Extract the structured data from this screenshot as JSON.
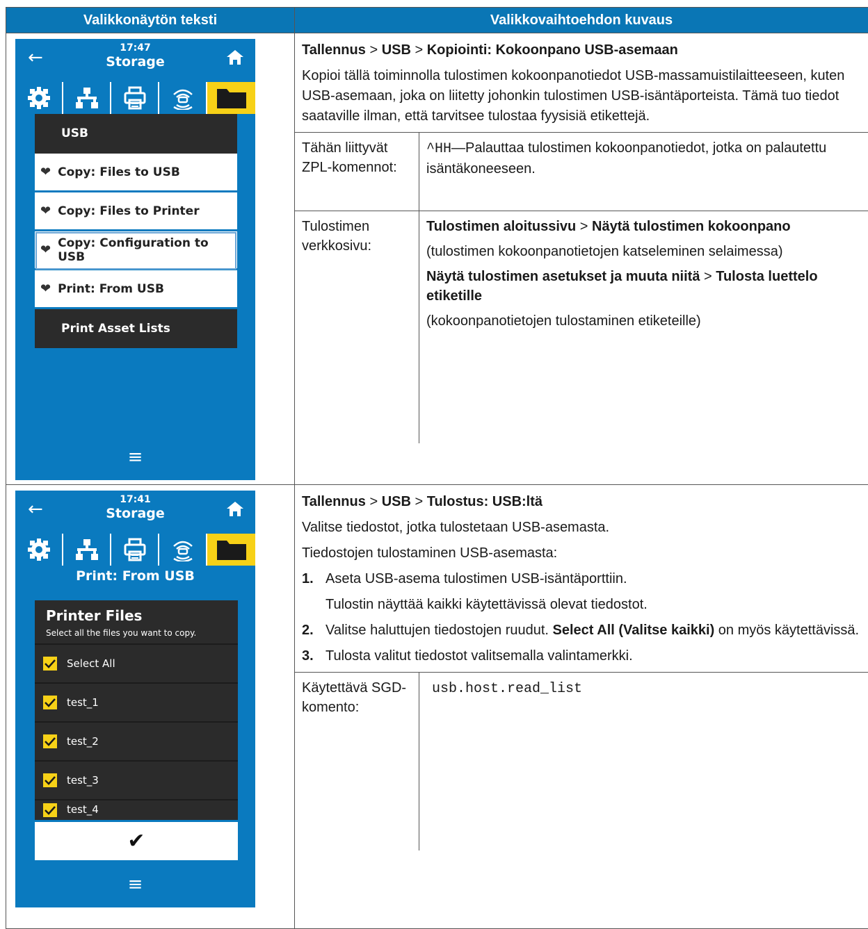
{
  "header": {
    "left": "Valikkonäytön teksti",
    "right": "Valikkovaihtoehdon kuvaus"
  },
  "colors": {
    "header_blue": "#0a76b5",
    "screen_blue": "#0a7abf",
    "active_tab_yellow": "#f7d117",
    "dark_panel": "#2b2b2b"
  },
  "row1": {
    "screen": {
      "time": "17:47",
      "title": "Storage",
      "icons": [
        "back-arrow-icon",
        "home-icon",
        "gear-icon",
        "network-icon",
        "printer-icon",
        "wireless-icon",
        "folder-icon"
      ],
      "menu_title": "USB",
      "items": [
        "Copy: Files to USB",
        "Copy: Files to Printer",
        "Copy: Configuration to USB",
        "Print: From USB"
      ],
      "selected_item": "Copy: Configuration to USB",
      "bottom_item": "Print Asset Lists"
    },
    "crumb": {
      "a": "Tallennus",
      "sep": ">",
      "b": "USB",
      "c": "Kopiointi: Kokoonpano USB-asemaan"
    },
    "description": "Kopioi tällä toiminnolla tulostimen kokoonpanotiedot USB-massamuistilaitteeseen, kuten USB-asemaan, joka on liitetty johonkin tulostimen USB-isäntäporteista. Tämä tuo tiedot saataville ilman, että tarvitsee tulostaa fyysisiä etikettejä.",
    "zpl_label": "Tähän liittyvät ZPL-komennot:",
    "zpl_code": "^HH",
    "zpl_text": "—Palauttaa tulostimen kokoonpanotiedot, jotka on palautettu isäntäkoneeseen.",
    "web_label": "Tulostimen verkkosivu:",
    "web_path1_a": "Tulostimen aloitussivu",
    "web_path1_b": "Näytä tulostimen kokoonpano",
    "web_note1": "(tulostimen kokoonpanotietojen katseleminen selaimessa)",
    "web_path2_a": "Näytä tulostimen asetukset ja muuta niitä",
    "web_path2_b": "Tulosta luettelo etiketille",
    "web_note2": "(kokoonpanotietojen tulostaminen etiketeille)"
  },
  "row2": {
    "screen": {
      "time": "17:41",
      "title": "Storage",
      "heading": "Print: From USB",
      "panel_title": "Printer Files",
      "panel_sub": "Select all the files you want to copy.",
      "items": [
        "Select All",
        "test_1",
        "test_2",
        "test_3",
        "test_4"
      ]
    },
    "crumb": {
      "a": "Tallennus",
      "sep": ">",
      "b": "USB",
      "c": "Tulostus: USB:ltä"
    },
    "intro1": "Valitse tiedostot, jotka tulostetaan USB-asemasta.",
    "intro2": "Tiedostojen tulostaminen USB-asemasta:",
    "steps": [
      {
        "num": "1.",
        "text": "Aseta USB-asema tulostimen USB-isäntäporttiin.",
        "sub": "Tulostin näyttää kaikki käytettävissä olevat tiedostot."
      },
      {
        "num": "2.",
        "text": "Valitse haluttujen tiedostojen ruudut. ",
        "bold": "Select All (Valitse kaikki)",
        "after": " on myös käytettävissä."
      },
      {
        "num": "3.",
        "text": "Tulosta valitut tiedostot valitsemalla valintamerkki."
      }
    ],
    "sgd_label": "Käytettävä SGD-komento:",
    "sgd_code": "usb.host.read_list"
  }
}
